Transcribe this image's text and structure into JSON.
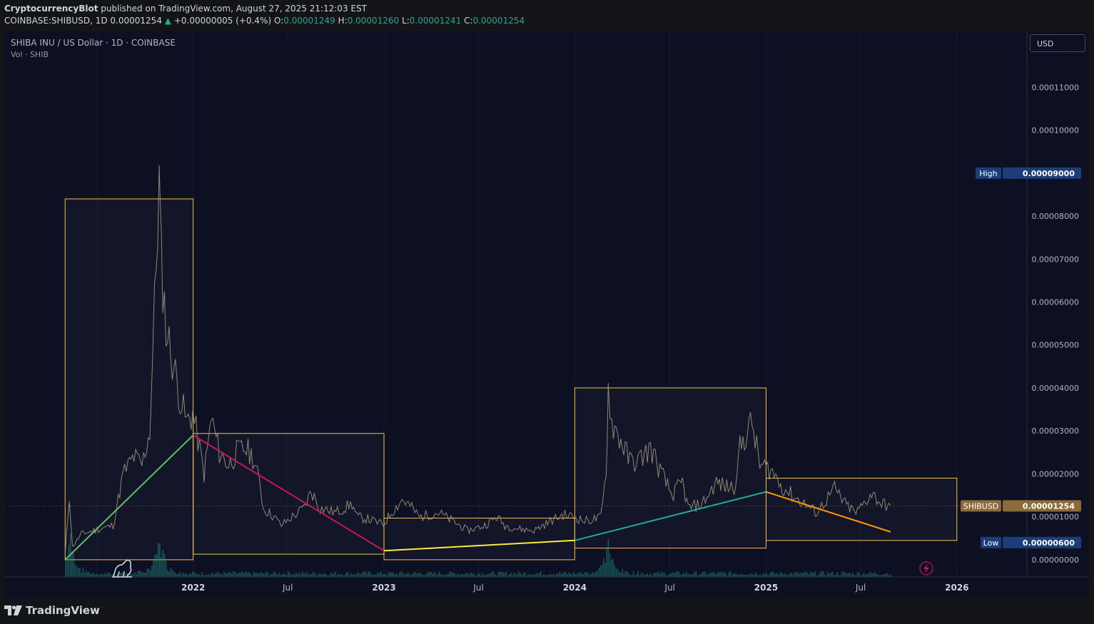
{
  "header": {
    "author": "CryptocurrencyBlot",
    "published_text": "published on TradingView.com, August 27, 2025 21:12:03 EST",
    "symbol_line": "COINBASE:SHIBUSD, 1D",
    "last_price": "0.00001254",
    "change": "+0.00000005 (+0.4%)",
    "o_label": "O:",
    "o_value": "0.00001249",
    "h_label": "H:",
    "h_value": "0.00001260",
    "l_label": "L:",
    "l_value": "0.00001241",
    "c_label": "C:",
    "c_value": "0.00001254"
  },
  "legend": {
    "title": "SHIBA INU / US Dollar · 1D · COINBASE",
    "volume": "Vol · SHIB"
  },
  "currency_button": "USD",
  "footer": {
    "brand": "TradingView"
  },
  "chart_data": {
    "type": "line",
    "series_kind": "candlestick-style price line with volume bars",
    "x_axis": {
      "ticks": [
        "2022",
        "Jul",
        "2023",
        "Jul",
        "2024",
        "Jul",
        "2025",
        "Jul",
        "2026"
      ]
    },
    "y_axis": {
      "ticks": [
        "0.00011000",
        "0.00010000",
        "0.00008000",
        "0.00007000",
        "0.00006000",
        "0.00005000",
        "0.00004000",
        "0.00003000",
        "0.00002000",
        "0.00001000",
        "0.00000000"
      ],
      "tick_values": [
        0.00011,
        0.0001,
        8e-05,
        7e-05,
        6e-05,
        5e-05,
        4e-05,
        3e-05,
        2e-05,
        1e-05,
        0.0
      ],
      "range": [
        -4e-06,
        0.000123
      ]
    },
    "x_range": [
      "2021-01-06",
      "2026-05-15"
    ],
    "price": [
      [
        "2021-05-01",
        1e-06
      ],
      [
        "2021-05-09",
        1.5e-05
      ],
      [
        "2021-05-15",
        3e-06
      ],
      [
        "2021-06-01",
        6e-06
      ],
      [
        "2021-07-01",
        7e-06
      ],
      [
        "2021-08-01",
        8e-06
      ],
      [
        "2021-08-20",
        2e-05
      ],
      [
        "2021-09-10",
        2.4e-05
      ],
      [
        "2021-09-25",
        2.2e-05
      ],
      [
        "2021-10-10",
        3e-05
      ],
      [
        "2021-10-28",
        8.8e-05
      ],
      [
        "2021-11-01",
        7e-05
      ],
      [
        "2021-11-10",
        5.4e-05
      ],
      [
        "2021-11-25",
        4.5e-05
      ],
      [
        "2021-12-10",
        3.6e-05
      ],
      [
        "2021-12-20",
        3.2e-05
      ],
      [
        "2021-12-31",
        3.4e-05
      ],
      [
        "2022-01-10",
        2.8e-05
      ],
      [
        "2022-01-22",
        2e-05
      ],
      [
        "2022-02-05",
        3.3e-05
      ],
      [
        "2022-02-20",
        2.5e-05
      ],
      [
        "2022-03-10",
        2.2e-05
      ],
      [
        "2022-03-25",
        2.5e-05
      ],
      [
        "2022-04-10",
        2.6e-05
      ],
      [
        "2022-04-25",
        2.4e-05
      ],
      [
        "2022-05-10",
        1.7e-05
      ],
      [
        "2022-05-15",
        1.2e-05
      ],
      [
        "2022-06-05",
        1e-05
      ],
      [
        "2022-06-18",
        8e-06
      ],
      [
        "2022-07-10",
        1e-05
      ],
      [
        "2022-08-01",
        1.2e-05
      ],
      [
        "2022-08-15",
        1.6e-05
      ],
      [
        "2022-09-01",
        1.2e-05
      ],
      [
        "2022-10-01",
        1.1e-05
      ],
      [
        "2022-11-01",
        1.3e-05
      ],
      [
        "2022-11-10",
        1e-05
      ],
      [
        "2022-12-01",
        9.5e-06
      ],
      [
        "2022-12-31",
        8.2e-06
      ],
      [
        "2023-01-15",
        1.1e-05
      ],
      [
        "2023-02-05",
        1.4e-05
      ],
      [
        "2023-02-20",
        1.25e-05
      ],
      [
        "2023-03-10",
        1e-05
      ],
      [
        "2023-04-15",
        1.1e-05
      ],
      [
        "2023-05-15",
        8.8e-06
      ],
      [
        "2023-06-10",
        6.8e-06
      ],
      [
        "2023-07-10",
        7.8e-06
      ],
      [
        "2023-08-05",
        1e-05
      ],
      [
        "2023-08-20",
        8e-06
      ],
      [
        "2023-09-15",
        7.2e-06
      ],
      [
        "2023-10-15",
        6.8e-06
      ],
      [
        "2023-11-10",
        8.6e-06
      ],
      [
        "2023-12-10",
        1.05e-05
      ],
      [
        "2023-12-31",
        1e-05
      ],
      [
        "2024-01-20",
        9e-06
      ],
      [
        "2024-02-20",
        9.8e-06
      ],
      [
        "2024-03-01",
        2e-05
      ],
      [
        "2024-03-05",
        4e-05
      ],
      [
        "2024-03-12",
        3.2e-05
      ],
      [
        "2024-04-01",
        2.7e-05
      ],
      [
        "2024-04-15",
        2.3e-05
      ],
      [
        "2024-05-01",
        2.3e-05
      ],
      [
        "2024-05-25",
        2.6e-05
      ],
      [
        "2024-06-15",
        2e-05
      ],
      [
        "2024-07-05",
        1.5e-05
      ],
      [
        "2024-07-25",
        1.8e-05
      ],
      [
        "2024-08-05",
        1.2e-05
      ],
      [
        "2024-09-01",
        1.3e-05
      ],
      [
        "2024-09-28",
        1.8e-05
      ],
      [
        "2024-10-15",
        1.7e-05
      ],
      [
        "2024-11-01",
        1.7e-05
      ],
      [
        "2024-11-12",
        2.6e-05
      ],
      [
        "2024-12-05",
        3.2e-05
      ],
      [
        "2024-12-20",
        2.2e-05
      ],
      [
        "2025-01-10",
        2.1e-05
      ],
      [
        "2025-02-01",
        1.7e-05
      ],
      [
        "2025-02-20",
        1.5e-05
      ],
      [
        "2025-03-15",
        1.3e-05
      ],
      [
        "2025-04-08",
        1.1e-05
      ],
      [
        "2025-05-12",
        1.65e-05
      ],
      [
        "2025-06-01",
        1.3e-05
      ],
      [
        "2025-06-22",
        1.08e-05
      ],
      [
        "2025-07-22",
        1.55e-05
      ],
      [
        "2025-08-10",
        1.3e-05
      ],
      [
        "2025-08-27",
        1.25e-05
      ]
    ],
    "annotations": {
      "boxes": [
        {
          "x": [
            "2021-05-01",
            "2022-01-01"
          ],
          "y": [
            0.0,
            8.4e-05
          ]
        },
        {
          "x": [
            "2022-01-01",
            "2023-01-01"
          ],
          "y": [
            1.3e-06,
            2.94e-05
          ]
        },
        {
          "x": [
            "2023-01-01",
            "2024-01-01"
          ],
          "y": [
            0.0,
            9.7e-06
          ]
        },
        {
          "x": [
            "2024-01-01",
            "2025-01-01"
          ],
          "y": [
            2.7e-06,
            4e-05
          ]
        },
        {
          "x": [
            "2025-01-01",
            "2026-01-01"
          ],
          "y": [
            4.5e-06,
            1.9e-05
          ]
        }
      ],
      "trendlines": [
        {
          "color": "#66bb6a",
          "from": [
            "2021-05-01",
            0.0
          ],
          "to": [
            "2022-01-01",
            2.9e-05
          ]
        },
        {
          "color": "#c2185b",
          "from": [
            "2022-01-01",
            2.9e-05
          ],
          "to": [
            "2023-01-01",
            2.1e-06
          ]
        },
        {
          "color": "#ffeb3b",
          "from": [
            "2023-01-01",
            2.1e-06
          ],
          "to": [
            "2024-01-01",
            4.5e-06
          ]
        },
        {
          "color": "#26a69a",
          "from": [
            "2024-01-01",
            4.5e-06
          ],
          "to": [
            "2025-01-01",
            1.58e-05
          ]
        },
        {
          "color": "#ff9800",
          "from": [
            "2025-01-01",
            1.58e-05
          ],
          "to": [
            "2025-08-27",
            6.5e-06
          ]
        }
      ]
    },
    "price_labels": {
      "high": {
        "label": "High",
        "value": "0.00009000",
        "v": 9e-05
      },
      "current": {
        "label": "SHIBUSD",
        "value": "0.00001254",
        "v": 1.254e-05
      },
      "low": {
        "label": "Low",
        "value": "0.00000600",
        "v": 4e-06
      }
    },
    "volume_spikes": [
      {
        "x": "2021-05-09",
        "v": 1.0
      },
      {
        "x": "2021-10-28",
        "v": 1.0
      },
      {
        "x": "2024-03-05",
        "v": 0.8
      }
    ]
  },
  "colors": {
    "background": "#0c1022",
    "price_line": "#a89b84",
    "box": "#f5c04a",
    "up": "#26a69a",
    "high_badge": "#1c3d7a",
    "current_badge": "#8d6a3a"
  }
}
